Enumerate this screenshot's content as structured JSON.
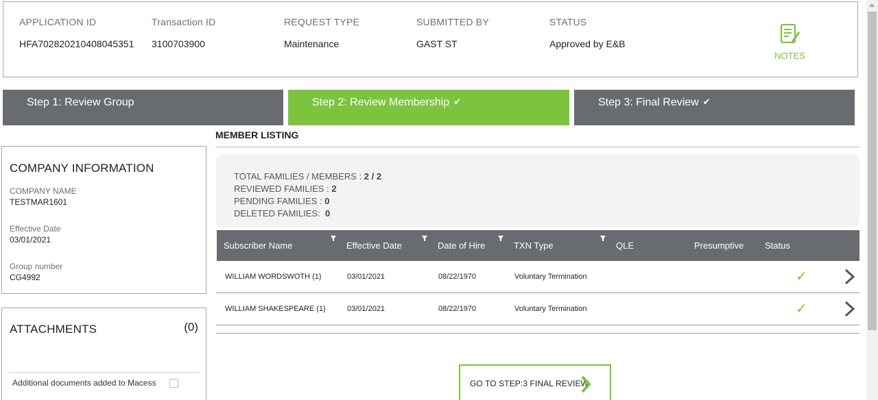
{
  "header": {
    "columns": [
      {
        "label": "APPLICATION ID",
        "value": "HFA702820210408045351"
      },
      {
        "label": "Transaction ID",
        "value": "3100703900"
      },
      {
        "label": "REQUEST TYPE",
        "value": "Maintenance"
      },
      {
        "label": "SUBMITTED BY",
        "value": "GAST ST"
      },
      {
        "label": "STATUS",
        "value": "Approved by E&B"
      }
    ],
    "notes_label": "NOTES",
    "notes_icon": "notes-icon"
  },
  "steps": [
    {
      "label": "Step 1: Review Group",
      "checked": false
    },
    {
      "label": "Step 2: Review Membership",
      "checked": true,
      "active": true
    },
    {
      "label": "Step 3: Final Review",
      "checked": true
    }
  ],
  "company": {
    "title": "COMPANY INFORMATION",
    "fields": [
      {
        "label": "COMPANY NAME",
        "value": "TESTMAR1601"
      },
      {
        "label": "Effective Date",
        "value": "03/01/2021"
      },
      {
        "label": "Group number",
        "value": "CG4992"
      }
    ]
  },
  "attachments": {
    "title": "ATTACHMENTS",
    "count": "(0)",
    "additional_label": "Additional documents added to Macess"
  },
  "member_listing": {
    "title": "MEMBER LISTING",
    "summary": {
      "total_label": "TOTAL FAMILIES / MEMBERS :",
      "total_value": "2 / 2",
      "reviewed_label": "REVIEWED FAMILIES :",
      "reviewed_value": "2",
      "pending_label": "PENDING FAMILIES :",
      "pending_value": "0",
      "deleted_label": "DELETED FAMILIES:",
      "deleted_value": "0"
    },
    "columns": [
      "Subscriber Name",
      "Effective Date",
      "Date of Hire",
      "TXN Type",
      "QLE",
      "Presumptive",
      "Status"
    ],
    "rows": [
      {
        "name": "WILLIAM WORDSWOTH (1)",
        "effective": "03/01/2021",
        "hire": "08/22/1970",
        "txn": "Voluntary Termination",
        "qle": "",
        "presumptive": "",
        "status": "approved"
      },
      {
        "name": "WILLIAM SHAKESPEARE (1)",
        "effective": "03/01/2021",
        "hire": "08/22/1970",
        "txn": "Voluntary Termination",
        "qle": "",
        "presumptive": "",
        "status": "approved"
      }
    ],
    "cta_label": "GO TO STEP:3 FINAL REVIEW"
  },
  "colors": {
    "accent": "#7dc340",
    "step_inactive": "#686c71"
  }
}
